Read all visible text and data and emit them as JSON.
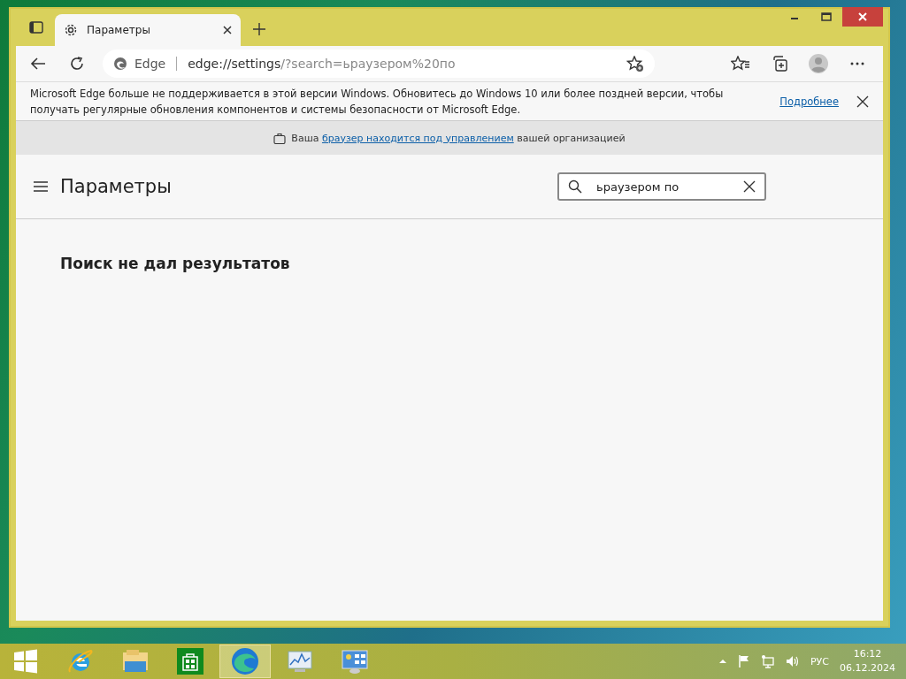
{
  "window": {
    "tabs": [
      {
        "title": "Параметры",
        "selected": true
      }
    ]
  },
  "address_bar": {
    "site": "Edge",
    "url_host": "edge://settings",
    "url_rest": "/?search=ьраузером%20по"
  },
  "info_bar": {
    "message": "Microsoft Edge больше не поддерживается в этой версии Windows. Обновитесь до Windows 10 или более поздней версии, чтобы получать регулярные обновления компонентов и системы безопасности от Microsoft Edge.",
    "link": "Подробнее"
  },
  "managed_bar": {
    "before": "Ваша",
    "link": "браузер находится под управлением",
    "after": "вашей организацией"
  },
  "settings": {
    "title": "Параметры",
    "search": {
      "value": "ьраузером по"
    },
    "empty_message": "Поиск не дал результатов"
  },
  "taskbar": {
    "items": [
      {
        "kind": "start",
        "active": false
      },
      {
        "kind": "ie",
        "active": false
      },
      {
        "kind": "explorer",
        "active": false
      },
      {
        "kind": "store",
        "active": false
      },
      {
        "kind": "edge",
        "active": true
      },
      {
        "kind": "monitor",
        "active": false
      },
      {
        "kind": "control",
        "active": false
      }
    ],
    "language": "РУС",
    "time": "16:12",
    "date": "06.12.2024"
  }
}
